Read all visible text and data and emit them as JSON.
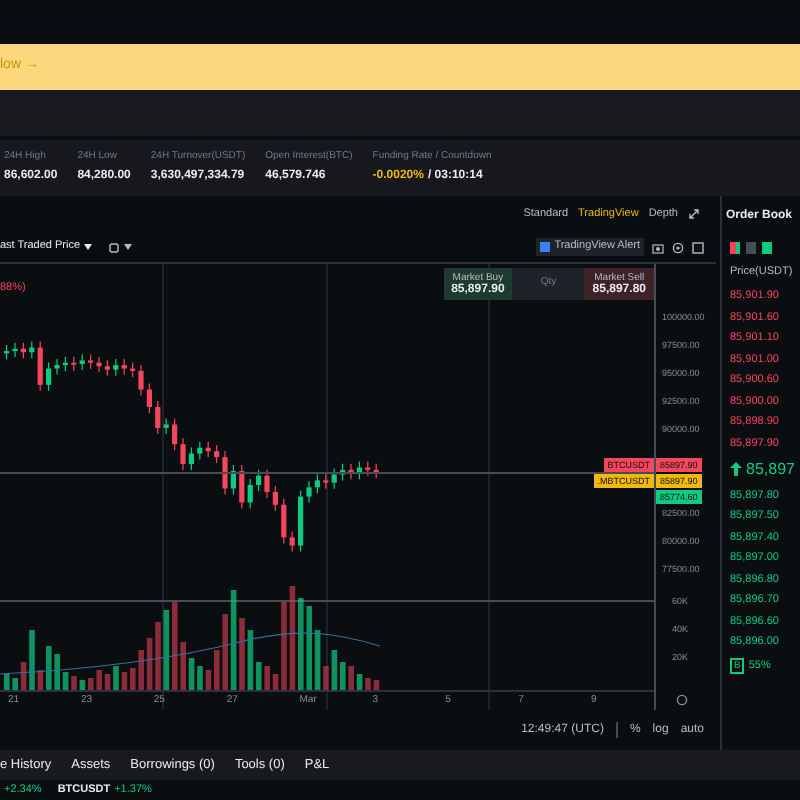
{
  "banner": {
    "text": "low →"
  },
  "stats": [
    {
      "label": "24H High",
      "value": "86,602.00"
    },
    {
      "label": "24H Low",
      "value": "84,280.00"
    },
    {
      "label": "24H Turnover(USDT)",
      "value": "3,630,497,334.79"
    },
    {
      "label": "Open Interest(BTC)",
      "value": "46,579.746"
    },
    {
      "label": "Funding Rate / Countdown",
      "value": "-0.0020%",
      "suffix": "/ 03:10:14"
    }
  ],
  "chart_views": [
    {
      "label": "Standard",
      "selected": false
    },
    {
      "label": "TradingView",
      "selected": true
    },
    {
      "label": "Depth",
      "selected": false
    }
  ],
  "price_source": "ast Traded Price",
  "alert_button": "TradingView Alert",
  "change_text": "88%)",
  "trade_panel": {
    "buy_label": "Market Buy",
    "buy_price": "85,897.90",
    "qty_placeholder": "Qty",
    "sell_label": "Market Sell",
    "sell_price": "85,897.80"
  },
  "price_axis": [
    "100000.00",
    "97500.00",
    "95000.00",
    "92500.00",
    "90000.00",
    "82500.00",
    "80000.00",
    "77500.00"
  ],
  "price_tags": [
    {
      "name": "BTCUSDT",
      "value": "85897.90",
      "color": "#f6465d"
    },
    {
      "name": ".MBTCUSDT",
      "value": "85897.90",
      "color": "#f0b90b"
    },
    {
      "value": "85774.60",
      "color": "#0ecb81"
    }
  ],
  "volume_axis": [
    "60K",
    "40K",
    "20K"
  ],
  "date_axis": [
    "21",
    "23",
    "25",
    "27",
    "Mar",
    "3",
    "5",
    "7",
    "9"
  ],
  "footer": {
    "time": "12:49:47 (UTC)",
    "buttons": [
      "%",
      "log",
      "auto"
    ]
  },
  "order_book": {
    "title": "Order Book",
    "column": "Price(USDT)",
    "asks": [
      "85,901.90",
      "85,901.60",
      "85,901.10",
      "85,901.00",
      "85,900.60",
      "85,900.00",
      "85,898.90",
      "85,897.90"
    ],
    "last_price": "85,897",
    "bids": [
      "85,897.80",
      "85,897.50",
      "85,897.40",
      "85,897.00",
      "85,896.80",
      "85,896.70",
      "85,896.60",
      "85,896.00"
    ],
    "ratio_side": "B",
    "ratio": "55%"
  },
  "bottom_tabs": [
    "e History",
    "Assets",
    "Borrowings (0)",
    "Tools (0)",
    "P&L"
  ],
  "ticker": [
    {
      "change": "+2.34%"
    },
    {
      "symbol": "BTCUSDT",
      "change": "+1.37%"
    }
  ]
}
